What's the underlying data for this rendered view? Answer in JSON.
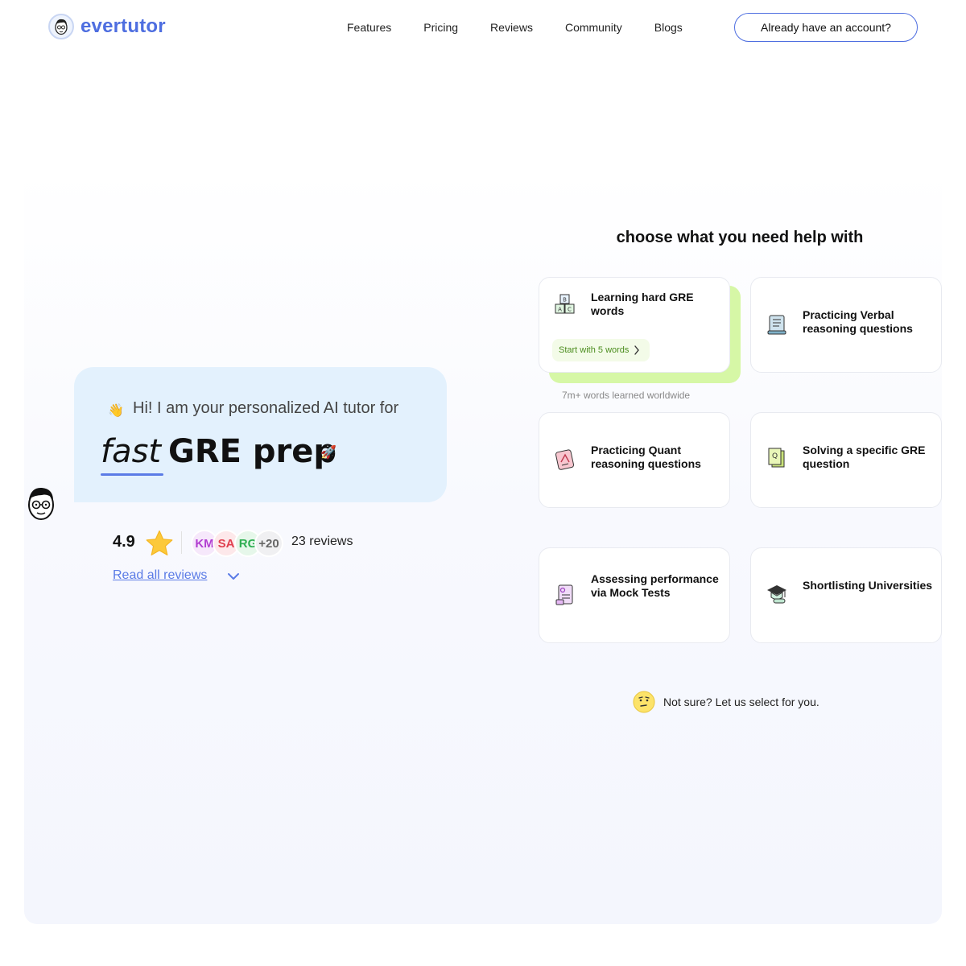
{
  "brand": {
    "name": "evertutor",
    "color": "#4e6ee0"
  },
  "nav": {
    "links": [
      "Features",
      "Pricing",
      "Reviews",
      "Community",
      "Blogs"
    ],
    "account_button": "Already have an account?"
  },
  "hero": {
    "intro": "Hi! I am your personalized AI tutor for",
    "headline_emphasis": "fast",
    "headline_main": "GRE prep",
    "rating": "4.9",
    "avatars": [
      "KM",
      "SA",
      "RG",
      "+20"
    ],
    "reviews_count": "23 reviews",
    "read_reviews": "Read all reviews"
  },
  "help": {
    "title": "choose what you need help with",
    "cards": [
      {
        "label": "Learning hard GRE words",
        "icon": "abc-blocks-icon",
        "action": "Start with 5 words"
      },
      {
        "label": "Practicing Verbal reasoning questions",
        "icon": "scroll-book-icon"
      },
      {
        "label": "Practicing Quant reasoning questions",
        "icon": "math-book-icon"
      },
      {
        "label": "Solving a specific GRE question",
        "icon": "question-paper-icon"
      },
      {
        "label": "Assessing performance via Mock Tests",
        "icon": "test-sheet-icon"
      },
      {
        "label": "Shortlisting Universities",
        "icon": "graduation-cap-icon"
      }
    ],
    "learned_note": "7m+ words learned worldwide",
    "not_sure": "Not sure? Let us select for you."
  },
  "colors": {
    "accent": "#5b7be6",
    "bubble": "#e3f1fd",
    "highlight_card": "#d6f7a6"
  }
}
